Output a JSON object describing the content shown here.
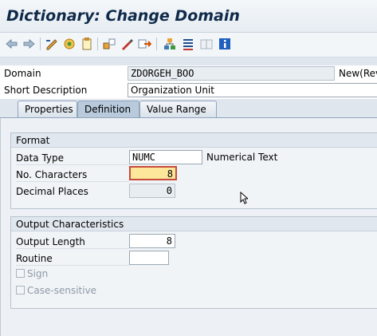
{
  "window": {
    "title": "Dictionary: Change Domain"
  },
  "toolbar": {
    "buttons": [
      "back-arrow-icon",
      "forward-arrow-icon",
      "edit-toggle-icon",
      "activate-icon",
      "where-used-icon",
      "object-list-icon",
      "display-object-icon",
      "navigate-icon",
      "hierarchy-icon",
      "documentation-icon",
      "book-icon",
      "info-icon"
    ]
  },
  "header": {
    "domain_label": "Domain",
    "domain_value": "ZDORGEH_BOO",
    "domain_status": "New(Rev",
    "short_desc_label": "Short Description",
    "short_desc_value": "Organization Unit"
  },
  "tabs": [
    {
      "label": "Properties",
      "active": false
    },
    {
      "label": "Definition",
      "active": true
    },
    {
      "label": "Value Range",
      "active": false
    }
  ],
  "format": {
    "title": "Format",
    "data_type_label": "Data Type",
    "data_type_value": "NUMC",
    "data_type_text": "Numerical Text",
    "no_chars_label": "No. Characters",
    "no_chars_value": "8",
    "decimal_label": "Decimal Places",
    "decimal_value": "0"
  },
  "output": {
    "title": "Output Characteristics",
    "length_label": "Output Length",
    "length_value": "8",
    "routine_label": "Routine",
    "routine_value": "",
    "sign_label": "Sign",
    "case_label": "Case-sensitive"
  },
  "colors": {
    "focus_fill": "#fce79a",
    "focus_border": "#c84a3c",
    "info_blue": "#1f5fbf"
  }
}
